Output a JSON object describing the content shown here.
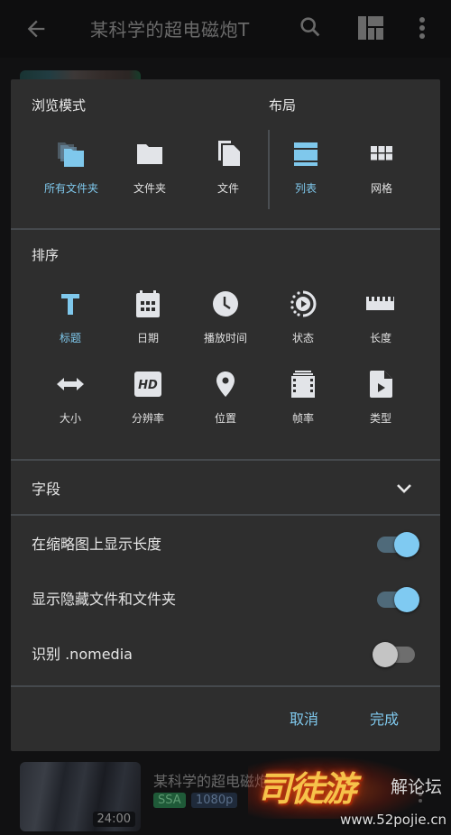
{
  "appbar": {
    "title": "某科学的超电磁炮T",
    "icons": [
      "arrow-back-icon",
      "search-icon",
      "layout-icon",
      "more-vert-icon"
    ]
  },
  "dialog": {
    "browse_mode": {
      "title": "浏览模式",
      "options": [
        {
          "label": "所有文件夹",
          "icon": "all-folders-icon",
          "selected": true
        },
        {
          "label": "文件夹",
          "icon": "folder-icon",
          "selected": false
        },
        {
          "label": "文件",
          "icon": "files-icon",
          "selected": false
        }
      ]
    },
    "layout": {
      "title": "布局",
      "options": [
        {
          "label": "列表",
          "icon": "list-icon",
          "selected": true
        },
        {
          "label": "网格",
          "icon": "grid-icon",
          "selected": false
        }
      ]
    },
    "sort": {
      "title": "排序",
      "options": [
        {
          "label": "标题",
          "icon": "title-icon",
          "selected": true
        },
        {
          "label": "日期",
          "icon": "calendar-icon",
          "selected": false
        },
        {
          "label": "播放时间",
          "icon": "clock-icon",
          "selected": false
        },
        {
          "label": "状态",
          "icon": "status-icon",
          "selected": false
        },
        {
          "label": "长度",
          "icon": "ruler-icon",
          "selected": false
        },
        {
          "label": "大小",
          "icon": "size-arrows-icon",
          "selected": false
        },
        {
          "label": "分辨率",
          "icon": "hd-icon",
          "selected": false
        },
        {
          "label": "位置",
          "icon": "location-icon",
          "selected": false
        },
        {
          "label": "帧率",
          "icon": "film-icon",
          "selected": false
        },
        {
          "label": "类型",
          "icon": "video-file-icon",
          "selected": false
        }
      ]
    },
    "fields": {
      "title": "字段",
      "expanded": false
    },
    "toggles": [
      {
        "label": "在缩略图上显示长度",
        "on": true
      },
      {
        "label": "显示隐藏文件和文件夹",
        "on": true
      },
      {
        "label": "识别 .nomedia",
        "on": false
      }
    ],
    "buttons": {
      "cancel": "取消",
      "done": "完成"
    }
  },
  "background_item": {
    "title": "某科学的超电磁炮T",
    "duration": "24:00",
    "badges": [
      "SSA",
      "1080p"
    ]
  },
  "watermark": {
    "logo": "司徒游",
    "forum": "解论坛",
    "url": "www.52pojie.cn"
  },
  "colors": {
    "accent": "#7fc8ec",
    "dialog_bg": "#2e2e2e",
    "icon": "#e2e4e8"
  }
}
